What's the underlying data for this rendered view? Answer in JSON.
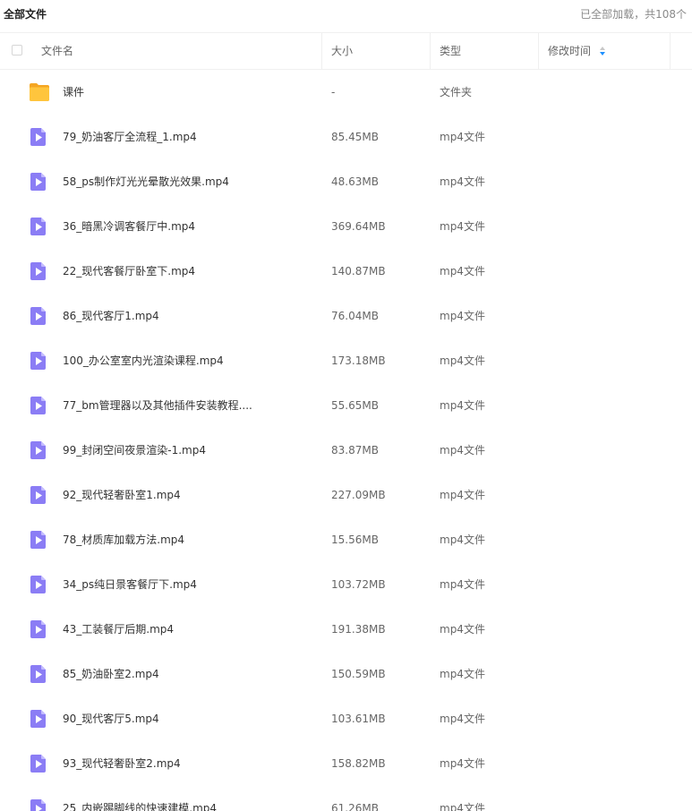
{
  "breadcrumb": {
    "title": "全部文件"
  },
  "status": {
    "text": "已全部加载，共108个"
  },
  "table": {
    "columns": {
      "name": "文件名",
      "size": "大小",
      "type": "类型",
      "modified": "修改时间"
    },
    "rows": [
      {
        "name": "课件",
        "size": "-",
        "type": "文件夹",
        "icon": "folder-icon"
      },
      {
        "name": "79_奶油客厅全流程_1.mp4",
        "size": "85.45MB",
        "type": "mp4文件",
        "icon": "video-file-icon"
      },
      {
        "name": "58_ps制作灯光光晕散光效果.mp4",
        "size": "48.63MB",
        "type": "mp4文件",
        "icon": "video-file-icon"
      },
      {
        "name": "36_暗黑冷调客餐厅中.mp4",
        "size": "369.64MB",
        "type": "mp4文件",
        "icon": "video-file-icon"
      },
      {
        "name": "22_现代客餐厅卧室下.mp4",
        "size": "140.87MB",
        "type": "mp4文件",
        "icon": "video-file-icon"
      },
      {
        "name": "86_现代客厅1.mp4",
        "size": "76.04MB",
        "type": "mp4文件",
        "icon": "video-file-icon"
      },
      {
        "name": "100_办公室室内光渲染课程.mp4",
        "size": "173.18MB",
        "type": "mp4文件",
        "icon": "video-file-icon"
      },
      {
        "name": "77_bm管理器以及其他插件安装教程....",
        "size": "55.65MB",
        "type": "mp4文件",
        "icon": "video-file-icon"
      },
      {
        "name": "99_封闭空间夜景渲染-1.mp4",
        "size": "83.87MB",
        "type": "mp4文件",
        "icon": "video-file-icon"
      },
      {
        "name": "92_现代轻奢卧室1.mp4",
        "size": "227.09MB",
        "type": "mp4文件",
        "icon": "video-file-icon"
      },
      {
        "name": "78_材质库加载方法.mp4",
        "size": "15.56MB",
        "type": "mp4文件",
        "icon": "video-file-icon"
      },
      {
        "name": "34_ps纯日景客餐厅下.mp4",
        "size": "103.72MB",
        "type": "mp4文件",
        "icon": "video-file-icon"
      },
      {
        "name": "43_工装餐厅后期.mp4",
        "size": "191.38MB",
        "type": "mp4文件",
        "icon": "video-file-icon"
      },
      {
        "name": "85_奶油卧室2.mp4",
        "size": "150.59MB",
        "type": "mp4文件",
        "icon": "video-file-icon"
      },
      {
        "name": "90_现代客厅5.mp4",
        "size": "103.61MB",
        "type": "mp4文件",
        "icon": "video-file-icon"
      },
      {
        "name": "93_现代轻奢卧室2.mp4",
        "size": "158.82MB",
        "type": "mp4文件",
        "icon": "video-file-icon"
      },
      {
        "name": "25_内嵌踢脚线的快速建模.mp4",
        "size": "61.26MB",
        "type": "mp4文件",
        "icon": "video-file-icon"
      }
    ]
  },
  "colors": {
    "video_icon": "#8b7df5",
    "folder_icon": "#ffc53d",
    "sort_active": "#1e90ff"
  }
}
